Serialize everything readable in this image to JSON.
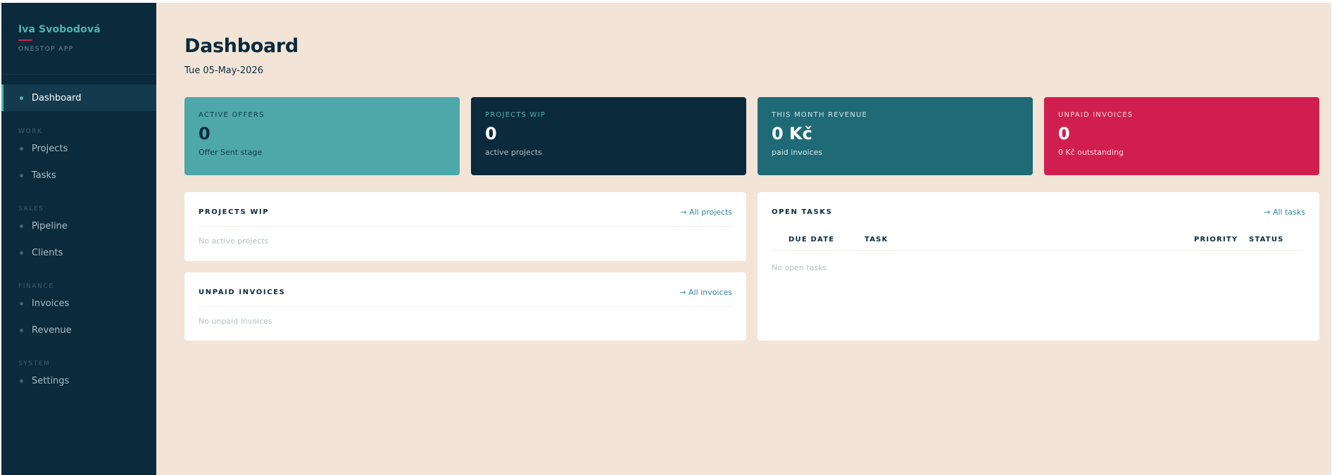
{
  "sidebar": {
    "user_name": "Iva Svobodová",
    "app_name": "ONESTOP APP",
    "items": [
      {
        "label": "Dashboard"
      },
      {
        "section": "WORK"
      },
      {
        "label": "Projects"
      },
      {
        "label": "Tasks"
      },
      {
        "section": "SALES"
      },
      {
        "label": "Pipeline"
      },
      {
        "label": "Clients"
      },
      {
        "section": "FINANCE"
      },
      {
        "label": "Invoices"
      },
      {
        "label": "Revenue"
      },
      {
        "section": "SYSTEM"
      },
      {
        "label": "Settings"
      }
    ]
  },
  "header": {
    "title": "Dashboard",
    "date": "Tue 05-May-2026"
  },
  "stats": [
    {
      "label": "ACTIVE OFFERS",
      "value": "0",
      "sub": "Offer Sent stage"
    },
    {
      "label": "PROJECTS WIP",
      "value": "0",
      "sub": "active projects"
    },
    {
      "label": "THIS MONTH REVENUE",
      "value": "0 Kč",
      "sub": "paid invoices"
    },
    {
      "label": "UNPAID INVOICES",
      "value": "0",
      "sub": "0 Kč outstanding"
    }
  ],
  "panels": {
    "projects_wip": {
      "title": "PROJECTS WIP",
      "link": "→ All projects",
      "empty": "No active projects"
    },
    "unpaid_invoices": {
      "title": "UNPAID INVOICES",
      "link": "→ All invoices",
      "empty": "No unpaid invoices"
    },
    "open_tasks": {
      "title": "OPEN TASKS",
      "link": "→ All tasks",
      "columns": [
        "DUE DATE",
        "TASK",
        "PRIORITY",
        "STATUS"
      ],
      "empty": "No open tasks"
    }
  },
  "colors": {
    "sidebar_bg": "#0b2b3d",
    "accent": "#4fb3ad",
    "main_bg": "#f2e4d7",
    "danger": "#d01f4f"
  }
}
